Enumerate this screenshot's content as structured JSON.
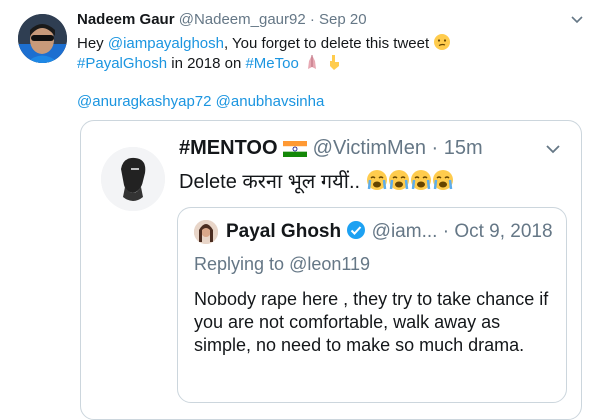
{
  "tweet": {
    "name": "Nadeem Gaur",
    "handle": "@Nadeem_gaur92",
    "separator": " · ",
    "date": "Sep 20",
    "line1_prefix": "Hey ",
    "line1_mention": "@iampayalghosh",
    "line1_suffix": ", You forget to delete this tweet",
    "line2_hashtag1": "#PayalGhosh",
    "line2_middle": " in 2018 on ",
    "line2_hashtag2": "#MeToo",
    "mention_a": "@anuragkashyap72",
    "mention_b": "@anubhavsinha"
  },
  "quoted": {
    "name": "#MENTOO",
    "handle": "@VictimMen",
    "separator": " · ",
    "time": "15m",
    "text": "Delete करना भूल गयीं.."
  },
  "nested": {
    "name": "Payal Ghosh",
    "handle": "@iam...",
    "separator": " · ",
    "date": "Oct 9, 2018",
    "reply_prefix": "Replying to ",
    "reply_handle": "@leon119",
    "body": "Nobody rape here , they try to take chance if you are not comfortable, walk away as simple, no need to make so much drama."
  },
  "colors": {
    "link": "#1b95e0",
    "muted": "#657786",
    "border": "#ccd6dd",
    "verified": "#1da1f2"
  },
  "icons": {
    "caret": "chevron-down-icon",
    "verified": "verified-badge-icon",
    "flag": "india-flag-icon"
  }
}
